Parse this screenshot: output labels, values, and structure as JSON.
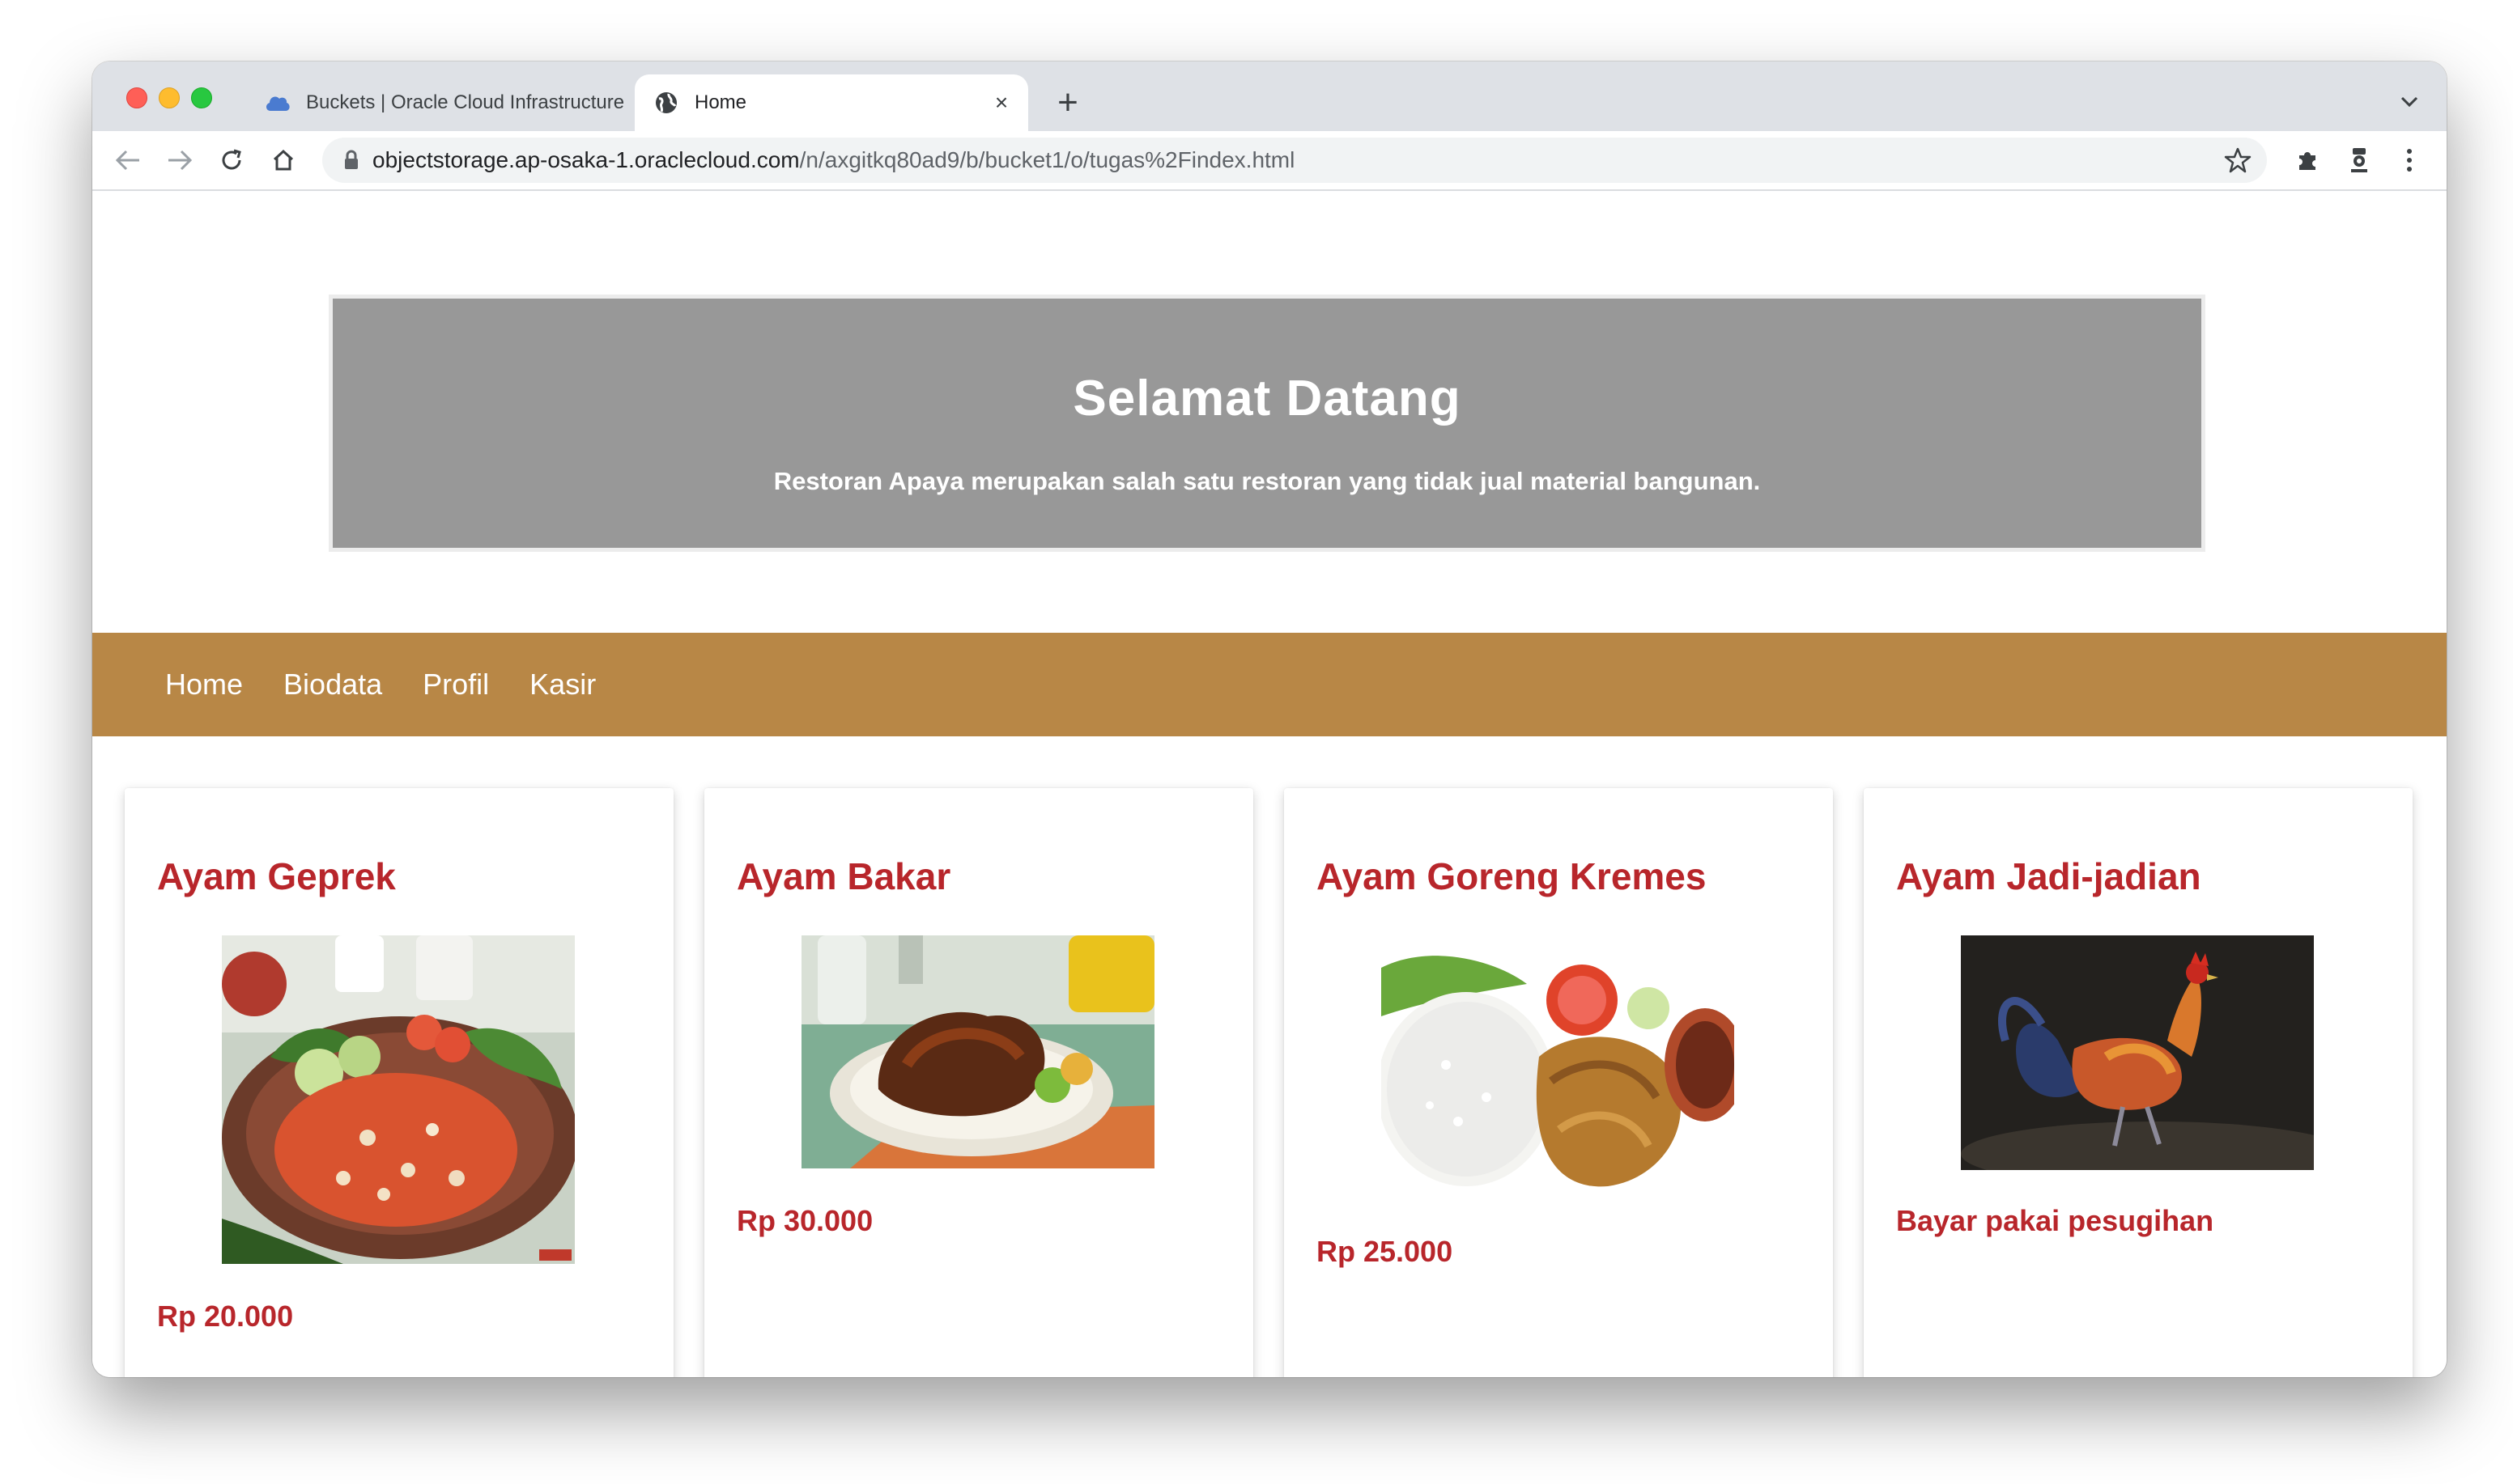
{
  "browser": {
    "tabs": [
      {
        "title": "Buckets | Oracle Cloud Infrastructure",
        "icon": "cloud-icon",
        "active": false
      },
      {
        "title": "Home",
        "icon": "globe-icon",
        "active": true
      }
    ],
    "url": {
      "host": "objectstorage.ap-osaka-1.oraclecloud.com",
      "path": "/n/axgitkq80ad9/b/bucket1/o/tugas%2Findex.html"
    }
  },
  "page": {
    "hero": {
      "title": "Selamat Datang",
      "subtitle": "Restoran Apaya merupakan salah satu restoran yang tidak jual material bangunan."
    },
    "nav": [
      "Home",
      "Biodata",
      "Profil",
      "Kasir"
    ],
    "menu": [
      {
        "name": "Ayam Geprek",
        "price": "Rp 20.000",
        "image": "ayam-geprek-photo"
      },
      {
        "name": "Ayam Bakar",
        "price": "Rp 30.000",
        "image": "ayam-bakar-photo"
      },
      {
        "name": "Ayam Goreng Kremes",
        "price": "Rp 25.000",
        "image": "ayam-goreng-kremes-photo"
      },
      {
        "name": "Ayam Jadi-jadian",
        "price": "Bayar pakai pesugihan",
        "image": "rooster-photo"
      }
    ]
  },
  "colors": {
    "hero_bg": "#989898",
    "nav_bg": "#b88746",
    "accent_text": "#b8262b"
  }
}
